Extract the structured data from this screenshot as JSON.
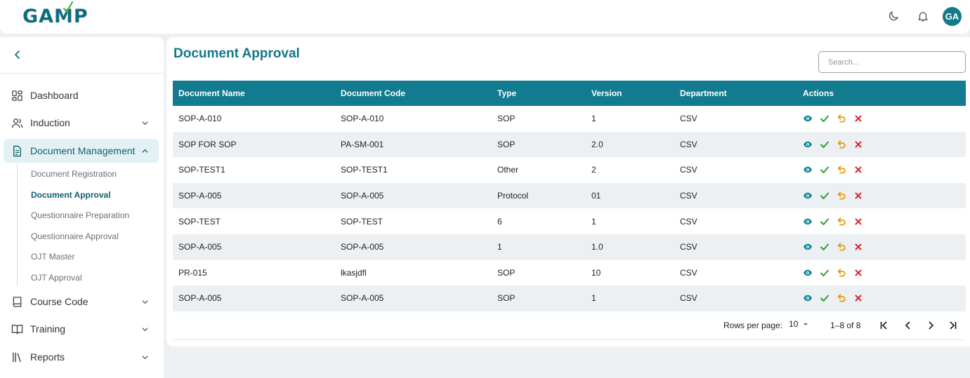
{
  "header": {
    "logo_text": "GAMP",
    "avatar_initials": "GA",
    "icons": [
      "moon-icon",
      "bell-icon"
    ]
  },
  "sidebar": {
    "items": [
      {
        "label": "Dashboard",
        "icon": "dashboard-icon"
      },
      {
        "label": "Induction",
        "icon": "users-icon"
      },
      {
        "label": "Document Management",
        "icon": "document-icon"
      },
      {
        "label": "Course Code",
        "icon": "book-icon"
      },
      {
        "label": "Training",
        "icon": "open-book-icon"
      },
      {
        "label": "Reports",
        "icon": "library-icon"
      }
    ],
    "sub_items": [
      "Document Registration",
      "Document Approval",
      "Questionnaire Preparation",
      "Questionnaire Approval",
      "OJT Master",
      "OJT Approval"
    ]
  },
  "main": {
    "title": "Document Approval",
    "search_placeholder": "Search..."
  },
  "table": {
    "columns": [
      "Document Name",
      "Document Code",
      "Type",
      "Version",
      "Department",
      "Actions"
    ],
    "rows": [
      [
        "SOP-A-010",
        "SOP-A-010",
        "SOP",
        "1",
        "CSV"
      ],
      [
        "SOP FOR SOP",
        "PA-SM-001",
        "SOP",
        "2.0",
        "CSV"
      ],
      [
        "SOP-TEST1",
        "SOP-TEST1",
        "Other",
        "2",
        "CSV"
      ],
      [
        "SOP-A-005",
        "SOP-A-005",
        "Protocol",
        "01",
        "CSV"
      ],
      [
        "SOP-TEST",
        "SOP-TEST",
        "6",
        "1",
        "CSV"
      ],
      [
        "SOP-A-005",
        "SOP-A-005",
        "1",
        "1.0",
        "CSV"
      ],
      [
        "PR-015",
        "lkasjdfl",
        "SOP",
        "10",
        "CSV"
      ],
      [
        "SOP-A-005",
        "SOP-A-005",
        "SOP",
        "1",
        "CSV"
      ]
    ]
  },
  "pagination": {
    "rows_per_page_label": "Rows per page:",
    "rows_per_page": "10",
    "range": "1–8 of 8"
  },
  "colors": {
    "accent": "#137b8f",
    "view": "#138a9c",
    "approve": "#2e9e3a",
    "revert": "#e59a11",
    "reject": "#e02424"
  }
}
